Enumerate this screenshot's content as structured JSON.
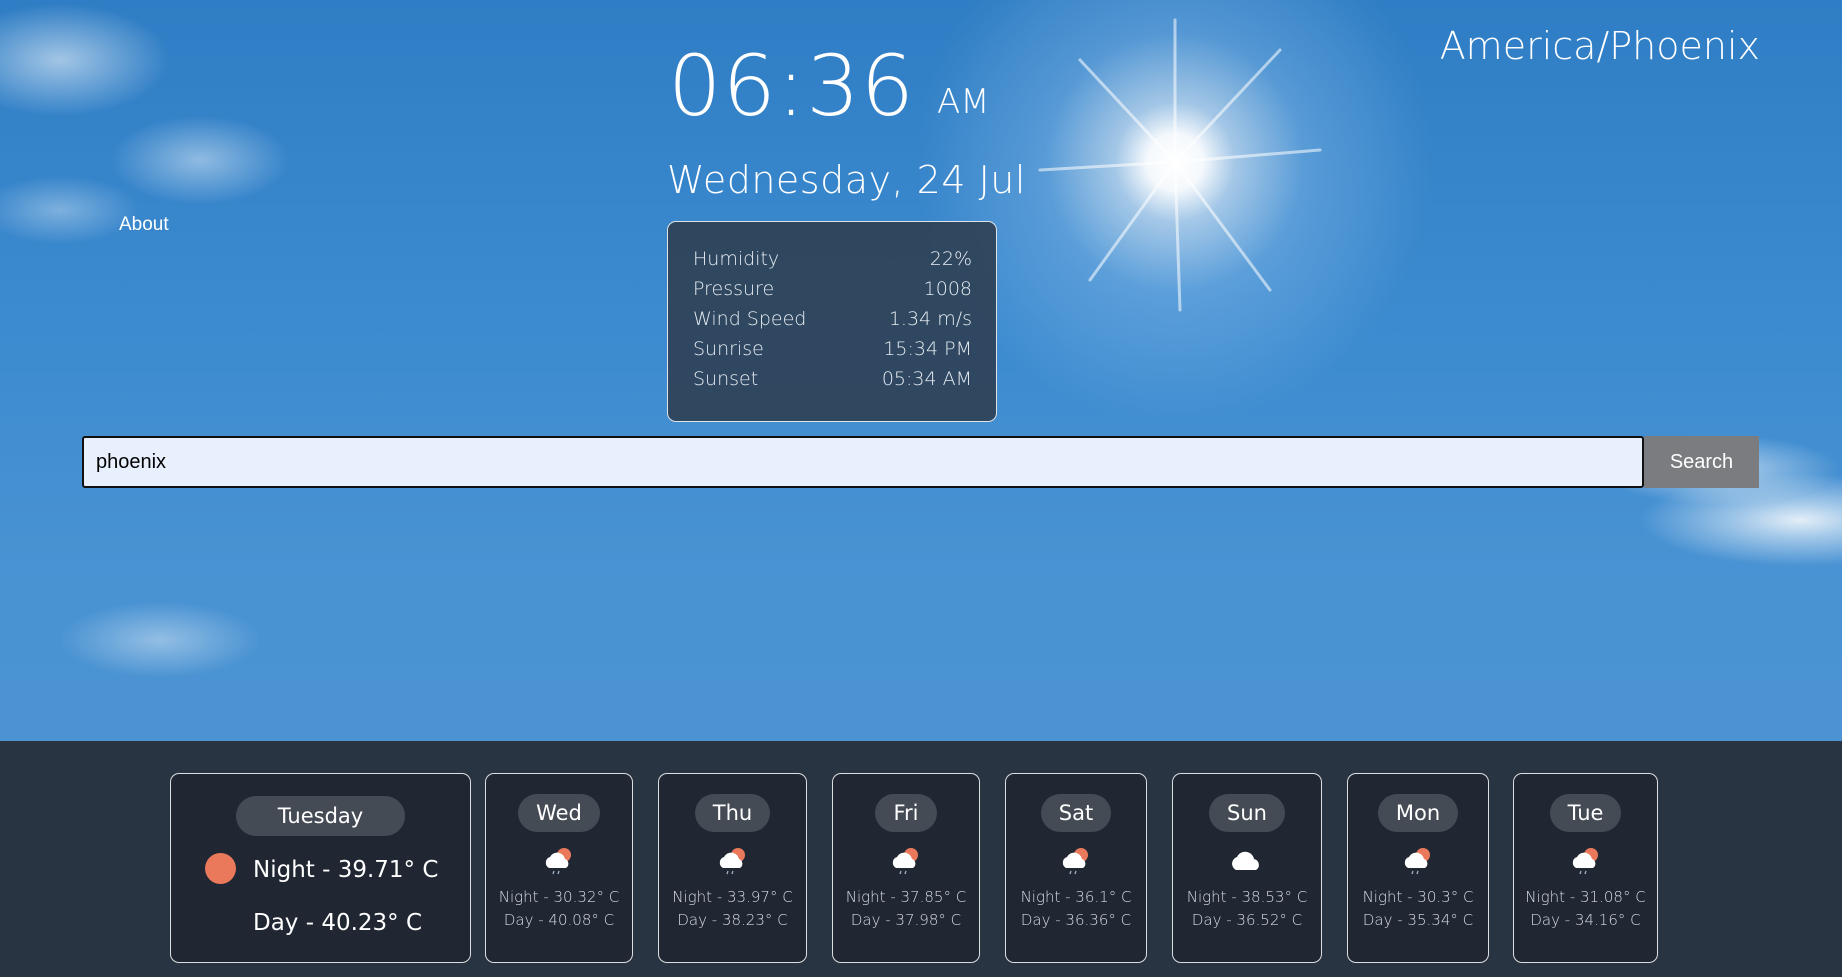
{
  "nav": {
    "about_label": "About"
  },
  "clock": {
    "time": "06:36",
    "ampm": "AM",
    "date": "Wednesday, 24 Jul"
  },
  "timezone": "America/Phoenix",
  "details": [
    {
      "label": "Humidity",
      "value": "22%"
    },
    {
      "label": "Pressure",
      "value": "1008"
    },
    {
      "label": "Wind Speed",
      "value": "1.34 m/s"
    },
    {
      "label": "Sunrise",
      "value": "15:34 PM"
    },
    {
      "label": "Sunset",
      "value": "05:34 AM"
    }
  ],
  "search": {
    "value": "phoenix",
    "button_label": "Search"
  },
  "today": {
    "day": "Tuesday",
    "night": "Night - 39.71° C",
    "day_temp": "Day - 40.23° C"
  },
  "forecast": [
    {
      "day": "Wed",
      "icon": "partly-cloudy-rain-icon",
      "night": "Night - 30.32° C",
      "day_temp": "Day - 40.08° C"
    },
    {
      "day": "Thu",
      "icon": "partly-cloudy-rain-icon",
      "night": "Night - 33.97° C",
      "day_temp": "Day - 38.23° C"
    },
    {
      "day": "Fri",
      "icon": "partly-cloudy-rain-icon",
      "night": "Night - 37.85° C",
      "day_temp": "Day - 37.98° C"
    },
    {
      "day": "Sat",
      "icon": "partly-cloudy-rain-icon",
      "night": "Night - 36.1° C",
      "day_temp": "Day - 36.36° C"
    },
    {
      "day": "Sun",
      "icon": "cloud-icon",
      "night": "Night - 38.53° C",
      "day_temp": "Day - 36.52° C"
    },
    {
      "day": "Mon",
      "icon": "partly-cloudy-rain-icon",
      "night": "Night - 30.3° C",
      "day_temp": "Day - 35.34° C"
    },
    {
      "day": "Tue",
      "icon": "partly-cloudy-rain-icon",
      "night": "Night - 31.08° C",
      "day_temp": "Day - 34.16° C"
    }
  ],
  "colors": {
    "sun_dot": "#e9795a",
    "panel": "#2d3e50",
    "search_button": "#7a7c7f"
  }
}
